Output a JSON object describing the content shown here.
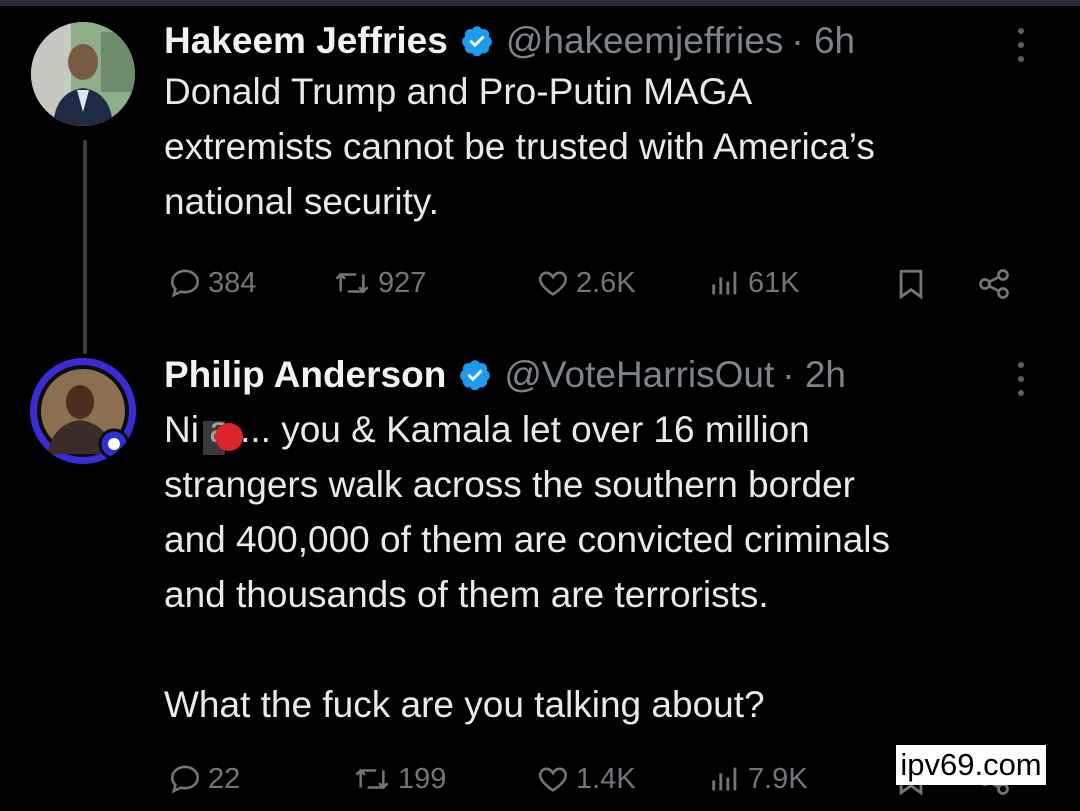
{
  "colors": {
    "background": "#000000",
    "text": "#e7e9ea",
    "muted": "#71767b",
    "verified": "#1d9bf0",
    "redaction": "#e0232a"
  },
  "tweets": [
    {
      "name": "Hakeem Jeffries",
      "handle": "@hakeemjeffries",
      "time": "· 6h",
      "text": "Donald Trump and Pro-Putin MAGA\nextremists cannot be trusted with America’s\nnational security.",
      "replies": "384",
      "retweets": "927",
      "likes": "2.6K",
      "views": "61K",
      "icons": [
        "reply-icon",
        "retweet-icon",
        "like-icon",
        "views-icon",
        "bookmark-icon",
        "share-icon"
      ]
    },
    {
      "name": "Philip Anderson",
      "handle": "@VoteHarrisOut",
      "time": "· 2h",
      "text": "Ni  a.... you & Kamala let over 16 million\nstrangers walk across the southern border\nand 400,000 of them are convicted criminals\nand thousands of them are terrorists.\n\nWhat the fuck are you talking about?",
      "replies": "22",
      "retweets": "199",
      "likes": "1.4K",
      "views": "7.9K"
    }
  ],
  "watermark": "ipv69.com"
}
